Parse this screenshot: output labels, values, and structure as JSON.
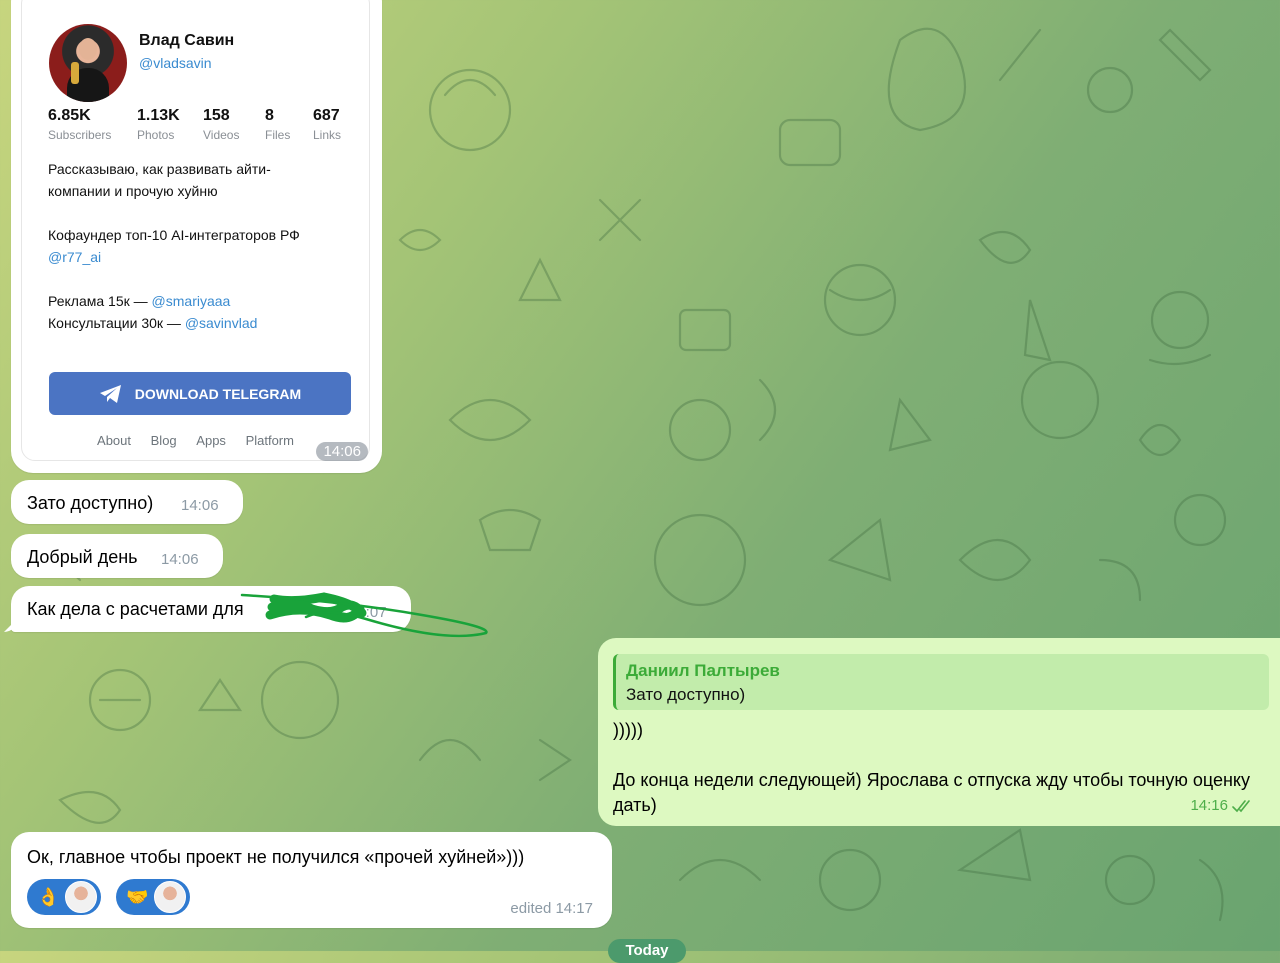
{
  "preview": {
    "name": "Влад Савин",
    "handle": "@vladsavin",
    "stats": [
      {
        "num": "6.85K",
        "label": "Subscribers"
      },
      {
        "num": "1.13K",
        "label": "Photos"
      },
      {
        "num": "158",
        "label": "Videos"
      },
      {
        "num": "8",
        "label": "Files"
      },
      {
        "num": "687",
        "label": "Links"
      }
    ],
    "desc_line1": "Рассказываю, как развивать айти-",
    "desc_line2": "компании и прочую хуйню",
    "cofounder_line": "Кофаундер топ-10 AI-интеграторов РФ",
    "cofounder_link": "@r77_ai",
    "ads_prefix": "Реклама 15к — ",
    "ads_link": "@smariyaaa",
    "consult_prefix": "Консультации 30к — ",
    "consult_link": "@savinvlad",
    "download_button": "DOWNLOAD TELEGRAM",
    "footer": [
      "About",
      "Blog",
      "Apps",
      "Platform"
    ],
    "time": "14:06"
  },
  "messages": [
    {
      "text": "Зато доступно)",
      "time": "14:06"
    },
    {
      "text": "Добрый день",
      "time": "14:06"
    },
    {
      "text": "Как дела с расчетами для",
      "time": "14:07"
    }
  ],
  "outgoing": {
    "reply_name": "Даниил Палтырев",
    "reply_text": "Зато доступно)",
    "line1": ")))))",
    "line2": "До конца недели следующей) Ярослава с отпуска жду чтобы точную оценку дать)",
    "time": "14:16"
  },
  "last_message": {
    "text": "Ок, главное чтобы проект не получился «прочей хуйней»)))",
    "edited": "edited 14:17",
    "reactions": [
      {
        "emoji": "👌"
      },
      {
        "emoji": "🤝"
      }
    ]
  },
  "date_pill": "Today",
  "colors": {
    "accent_blue": "#3a8bd0",
    "outgoing_bg": "#ddf9c1",
    "reply_green": "#3cab38",
    "scribble": "#1ea53a"
  }
}
